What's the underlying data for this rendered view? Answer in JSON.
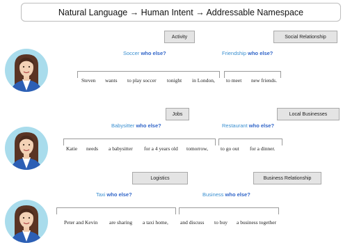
{
  "title": "Natural Language →  Human Intent → Addressable Namespace",
  "rows": [
    {
      "categories": [
        "Activity",
        "Social Relationship"
      ],
      "intents": [
        {
          "prefix": "Soccer ",
          "suffix": "who else?"
        },
        {
          "prefix": "Friendship ",
          "suffix": "who else?"
        }
      ],
      "words": [
        "Steven",
        "wants",
        "to play soccer",
        "tonight",
        "in London,",
        "to meet",
        "new friends."
      ]
    },
    {
      "categories": [
        "Jobs",
        "Local Businesses"
      ],
      "intents": [
        {
          "prefix": "Babysitter ",
          "suffix": "who else?"
        },
        {
          "prefix": "Restaurant ",
          "suffix": "who else?"
        }
      ],
      "words": [
        "Katie",
        "needs",
        "a babysitter",
        "for a 4 years old",
        "tomorrow,",
        "to go out",
        "for a dinner."
      ]
    },
    {
      "categories": [
        "Logistics",
        "Business Relationship"
      ],
      "intents": [
        {
          "prefix": "Taxi ",
          "suffix": "who else?"
        },
        {
          "prefix": "Business ",
          "suffix": "who else?"
        }
      ],
      "words": [
        "Peter and Kevin",
        "are sharing",
        "a taxi home,",
        "and discuss",
        "to buy",
        "a business together"
      ]
    }
  ],
  "colors": {
    "intent": "#3a8fd0",
    "intent_bold": "#2f64c8",
    "avatar_bg": "#a9dcec",
    "blazer": "#2c5fb5"
  }
}
